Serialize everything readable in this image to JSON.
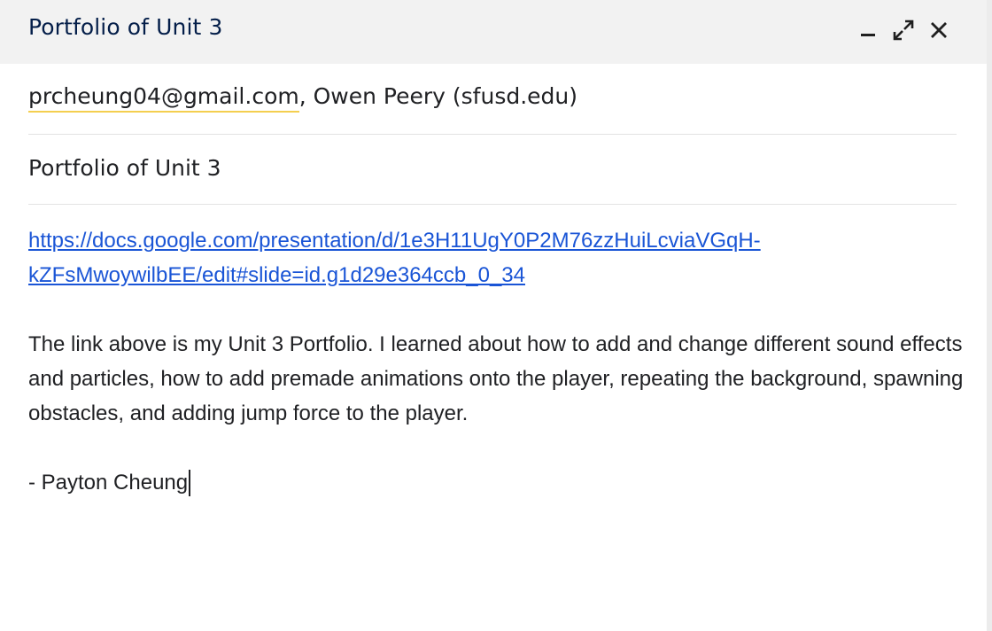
{
  "window": {
    "title": "Portfolio of Unit 3",
    "controls": {
      "minimize_icon": "minimize-icon",
      "expand_icon": "expand-icon",
      "close_icon": "close-icon"
    }
  },
  "recipients": {
    "first": "prcheung04@gmail.com",
    "separator": ",",
    "second": "Owen Peery (sfusd.edu)"
  },
  "subject": "Portfolio of Unit 3",
  "body": {
    "link_line1": "https://docs.google.com/presentation/d/1e3H11UgY0P2M76zzHuiLcviaVGqH-",
    "link_line2": "kZFsMwoywilbEE/edit#slide=id.g1d29e364ccb_0_34",
    "paragraph": "The link above is my Unit 3 Portfolio. I learned about how to add and change different sound effects and particles, how to add premade animations onto the player, repeating the background, spawning obstacles, and adding jump force to the player.",
    "signature": "- Payton Cheung"
  },
  "colors": {
    "titlebar_bg": "#f2f2f2",
    "title_text": "#041e49",
    "link": "#1a55d6",
    "recipient_underline": "#f4cf4f"
  }
}
